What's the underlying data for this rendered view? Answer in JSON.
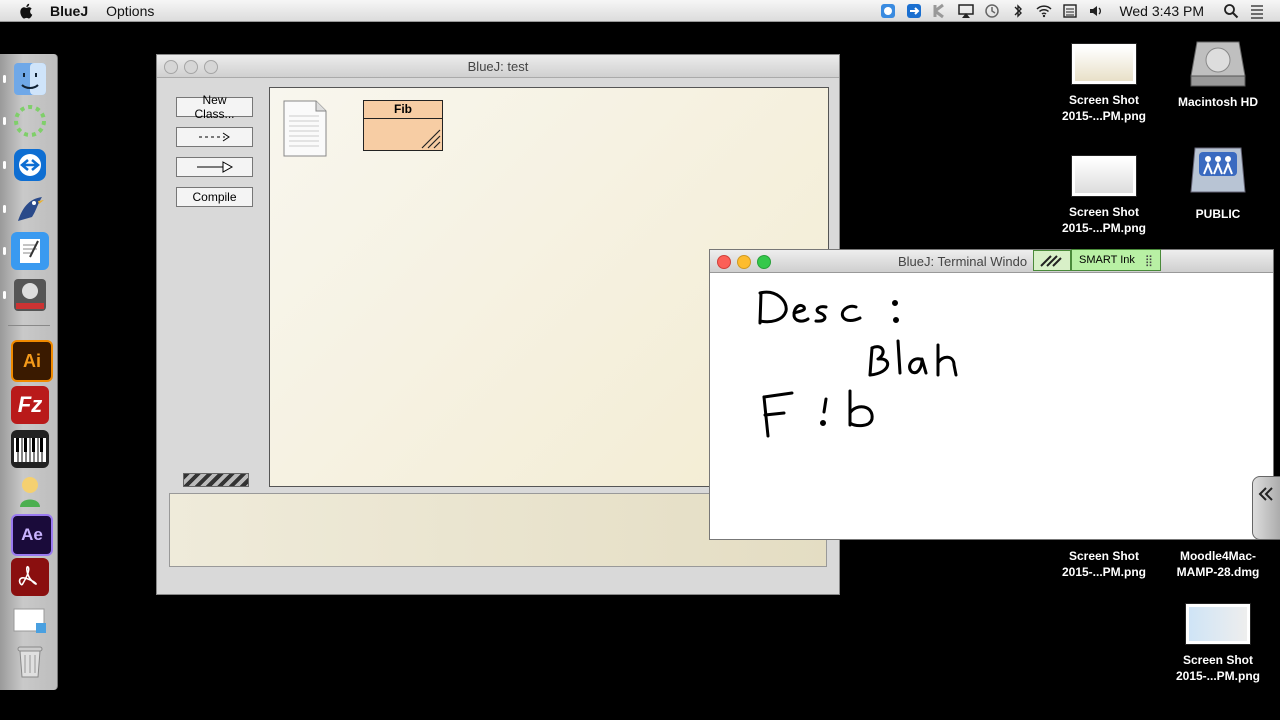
{
  "menubar": {
    "app_name": "BlueJ",
    "menus": [
      "Options"
    ],
    "clock": "Wed 3:43 PM"
  },
  "bluej": {
    "title": "BlueJ:  test",
    "buttons": {
      "new_class": "New Class...",
      "uses_arrow": "--->",
      "inherit_arrow": "—▷",
      "compile": "Compile"
    },
    "class_box": {
      "name": "Fib",
      "color": "#f7cda4"
    }
  },
  "terminal": {
    "title": "BlueJ: Terminal Windo",
    "smart_ink_label": "SMART Ink",
    "ink_text": [
      "Desc:",
      "Blah",
      "F!b"
    ]
  },
  "desktop": [
    {
      "label_line1": "Screen Shot",
      "label_line2": "2015-...PM.png"
    },
    {
      "label_line1": "Macintosh HD",
      "label_line2": ""
    },
    {
      "label_line1": "Screen Shot",
      "label_line2": "2015-...PM.png"
    },
    {
      "label_line1": "PUBLIC",
      "label_line2": ""
    },
    {
      "label_line1": "Screen Shot",
      "label_line2": "2015-...PM.png"
    },
    {
      "label_line1": "Moodle4Mac-",
      "label_line2": "MAMP-28.dmg"
    },
    {
      "label_line1": "Screen Shot",
      "label_line2": "2015-...PM.png"
    }
  ],
  "dock_apps": [
    "finder",
    "activity",
    "teamviewer",
    "bluej",
    "textedit",
    "notebook",
    "illustrator",
    "filezilla",
    "midi",
    "character",
    "after-effects",
    "acrobat",
    "preview",
    "trash"
  ]
}
